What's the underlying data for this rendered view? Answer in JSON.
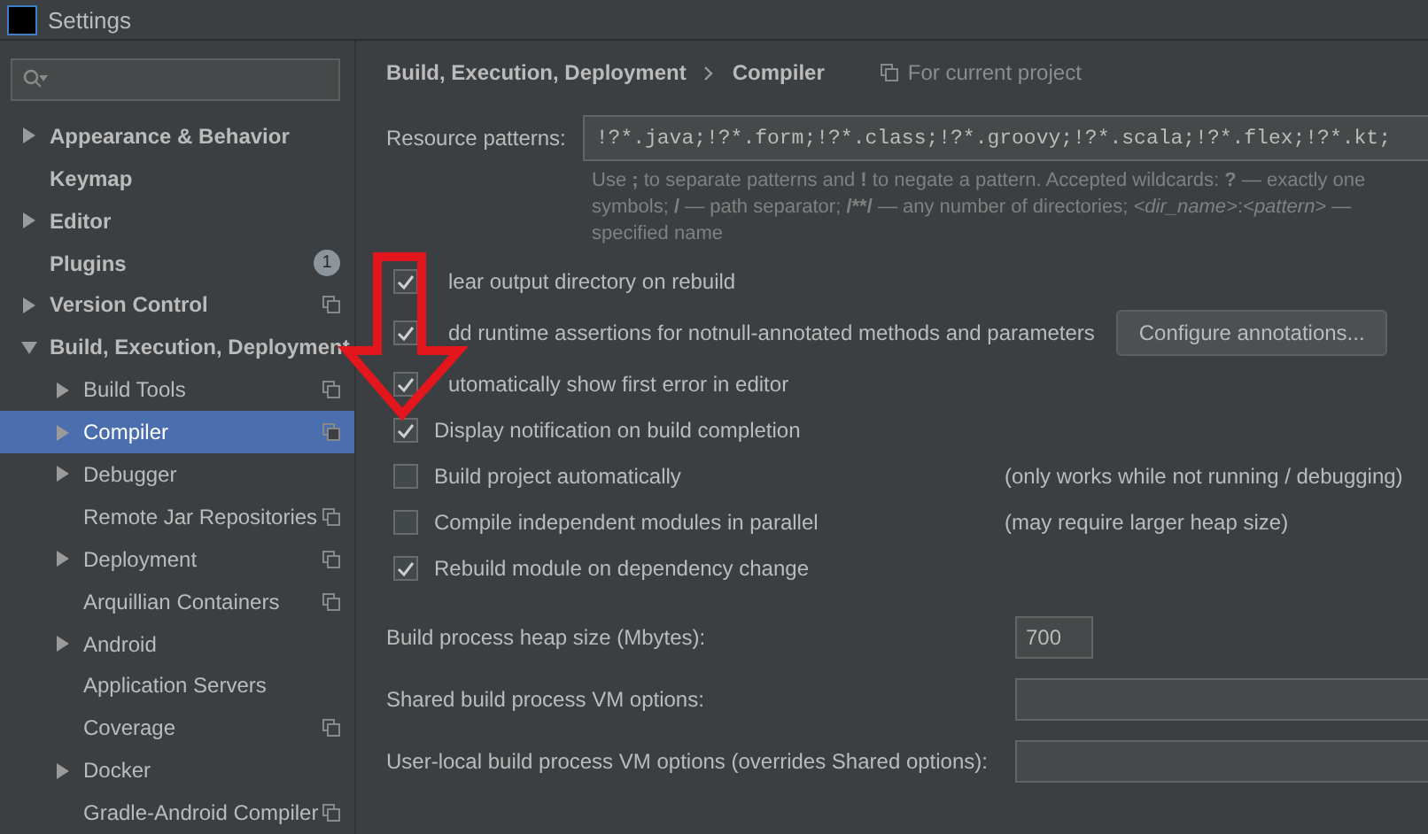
{
  "window": {
    "title": "Settings"
  },
  "sidebar": {
    "items": [
      {
        "label": "Appearance & Behavior",
        "expandable": true,
        "expanded": false,
        "selected": false,
        "project_level": false
      },
      {
        "label": "Keymap",
        "expandable": false,
        "selected": false,
        "project_level": false
      },
      {
        "label": "Editor",
        "expandable": true,
        "expanded": false,
        "selected": false,
        "project_level": false
      },
      {
        "label": "Plugins",
        "expandable": false,
        "selected": false,
        "project_level": false,
        "badge": "1"
      },
      {
        "label": "Version Control",
        "expandable": true,
        "expanded": false,
        "selected": false,
        "project_level": true
      },
      {
        "label": "Build, Execution, Deployment",
        "expandable": true,
        "expanded": true,
        "selected": false,
        "project_level": false,
        "children": [
          {
            "label": "Build Tools",
            "expandable": true,
            "expanded": false,
            "selected": false,
            "project_level": true
          },
          {
            "label": "Compiler",
            "expandable": true,
            "expanded": false,
            "selected": true,
            "project_level": true
          },
          {
            "label": "Debugger",
            "expandable": true,
            "expanded": false,
            "selected": false,
            "project_level": false
          },
          {
            "label": "Remote Jar Repositories",
            "expandable": false,
            "selected": false,
            "project_level": true
          },
          {
            "label": "Deployment",
            "expandable": true,
            "expanded": false,
            "selected": false,
            "project_level": true
          },
          {
            "label": "Arquillian Containers",
            "expandable": false,
            "selected": false,
            "project_level": true
          },
          {
            "label": "Android",
            "expandable": true,
            "expanded": false,
            "selected": false,
            "project_level": false
          },
          {
            "label": "Application Servers",
            "expandable": false,
            "selected": false,
            "project_level": false
          },
          {
            "label": "Coverage",
            "expandable": false,
            "selected": false,
            "project_level": true
          },
          {
            "label": "Docker",
            "expandable": true,
            "expanded": false,
            "selected": false,
            "project_level": false
          },
          {
            "label": "Gradle-Android Compiler",
            "expandable": false,
            "selected": false,
            "project_level": true
          }
        ]
      }
    ]
  },
  "breadcrumb": [
    "Build, Execution, Deployment",
    "Compiler"
  ],
  "scope_note": "For current project",
  "resource_patterns": {
    "label": "Resource patterns:",
    "value": "!?*.java;!?*.form;!?*.class;!?*.groovy;!?*.scala;!?*.flex;!?*.kt;",
    "hint_lines": [
      [
        {
          "text": "Use ",
          "kind": "plain"
        },
        {
          "text": ";",
          "kind": "bold"
        },
        {
          "text": " to separate patterns and ",
          "kind": "plain"
        },
        {
          "text": "!",
          "kind": "bold"
        },
        {
          "text": " to negate a pattern. Accepted wildcards: ",
          "kind": "plain"
        },
        {
          "text": "?",
          "kind": "bold"
        },
        {
          "text": " — exactly one",
          "kind": "plain"
        }
      ],
      [
        {
          "text": "symbols; ",
          "kind": "plain"
        },
        {
          "text": "/",
          "kind": "bold"
        },
        {
          "text": " — path separator; ",
          "kind": "plain"
        },
        {
          "text": "/**/",
          "kind": "bold"
        },
        {
          "text": " — any number of directories; ",
          "kind": "plain"
        },
        {
          "text": "<dir_name>",
          "kind": "italic"
        },
        {
          "text": ":",
          "kind": "plain"
        },
        {
          "text": "<pattern>",
          "kind": "italic"
        },
        {
          "text": " —",
          "kind": "plain"
        }
      ],
      [
        {
          "text": "specified name",
          "kind": "plain"
        }
      ]
    ]
  },
  "options": [
    {
      "label": "lear output directory on rebuild",
      "checked": true
    },
    {
      "label": "dd runtime assertions for notnull-annotated methods and parameters",
      "checked": true,
      "button": "Configure annotations..."
    },
    {
      "label": "utomatically show first error in editor",
      "checked": true
    },
    {
      "label": "Display notification on build completion",
      "checked": true
    },
    {
      "label": "Build project automatically",
      "checked": false,
      "note": "(only works while not running / debugging)"
    },
    {
      "label": "Compile independent modules in parallel",
      "checked": false,
      "note": "(may require larger heap size)"
    },
    {
      "label": "Rebuild module on dependency change",
      "checked": true
    }
  ],
  "fields": [
    {
      "label": "Build process heap size (Mbytes):",
      "value": "700",
      "kind": "short"
    },
    {
      "label": "Shared build process VM options:",
      "kind": "wide"
    },
    {
      "label": "User-local build process VM options (overrides Shared options):",
      "kind": "wide"
    }
  ]
}
